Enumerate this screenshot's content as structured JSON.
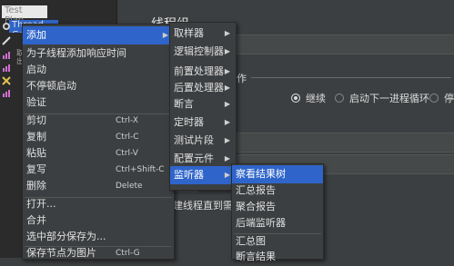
{
  "tree": {
    "test_plan": "Test Plan",
    "thread_group": "Thread Group",
    "vertical_text": "取出"
  },
  "main": {
    "panel_title": "线程组",
    "action_suffix": "作",
    "radio_continue": "继续",
    "radio_next_loop": "启动下一进程循环",
    "radio_stop_partial": "停",
    "add_label": "添加",
    "delay_text": "建线程直到需",
    "arrow": "▸"
  },
  "context_menu": {
    "items": [
      {
        "label": "添加",
        "shortcut": "",
        "has_submenu": true,
        "selected": true
      },
      {
        "label": "为子线程添加响应时间",
        "shortcut": "",
        "has_submenu": false,
        "selected": false
      },
      {
        "label": "启动",
        "shortcut": "",
        "has_submenu": false,
        "selected": false
      },
      {
        "label": "不停顿启动",
        "shortcut": "",
        "has_submenu": false,
        "selected": false
      },
      {
        "label": "验证",
        "shortcut": "",
        "has_submenu": false,
        "selected": false
      },
      {
        "label": "剪切",
        "shortcut": "Ctrl-X",
        "has_submenu": false,
        "selected": false
      },
      {
        "label": "复制",
        "shortcut": "Ctrl-C",
        "has_submenu": false,
        "selected": false
      },
      {
        "label": "粘贴",
        "shortcut": "Ctrl-V",
        "has_submenu": false,
        "selected": false
      },
      {
        "label": "复写",
        "shortcut": "Ctrl+Shift-C",
        "has_submenu": false,
        "selected": false
      },
      {
        "label": "删除",
        "shortcut": "Delete",
        "has_submenu": false,
        "selected": false
      },
      {
        "label": "打开...",
        "shortcut": "",
        "has_submenu": false,
        "selected": false
      },
      {
        "label": "合并",
        "shortcut": "",
        "has_submenu": false,
        "selected": false
      },
      {
        "label": "选中部分保存为...",
        "shortcut": "",
        "has_submenu": false,
        "selected": false
      },
      {
        "label": "保存节点为图片",
        "shortcut": "Ctrl-G",
        "has_submenu": false,
        "selected": false
      }
    ]
  },
  "add_submenu": {
    "items": [
      {
        "label": "取样器",
        "selected": false
      },
      {
        "label": "逻辑控制器",
        "selected": false
      },
      {
        "label": "前置处理器",
        "selected": false
      },
      {
        "label": "后置处理器",
        "selected": false
      },
      {
        "label": "断言",
        "selected": false
      },
      {
        "label": "定时器",
        "selected": false
      },
      {
        "label": "测试片段",
        "selected": false
      },
      {
        "label": "配置元件",
        "selected": false
      },
      {
        "label": "监听器",
        "selected": true
      }
    ]
  },
  "listener_submenu": {
    "items": [
      {
        "label": "察看结果树",
        "selected": true
      },
      {
        "label": "汇总报告",
        "selected": false
      },
      {
        "label": "聚合报告",
        "selected": false
      },
      {
        "label": "后端监听器",
        "selected": false
      },
      {
        "label": "汇总图",
        "selected": false
      },
      {
        "label": "断言结果",
        "selected": false
      }
    ]
  }
}
